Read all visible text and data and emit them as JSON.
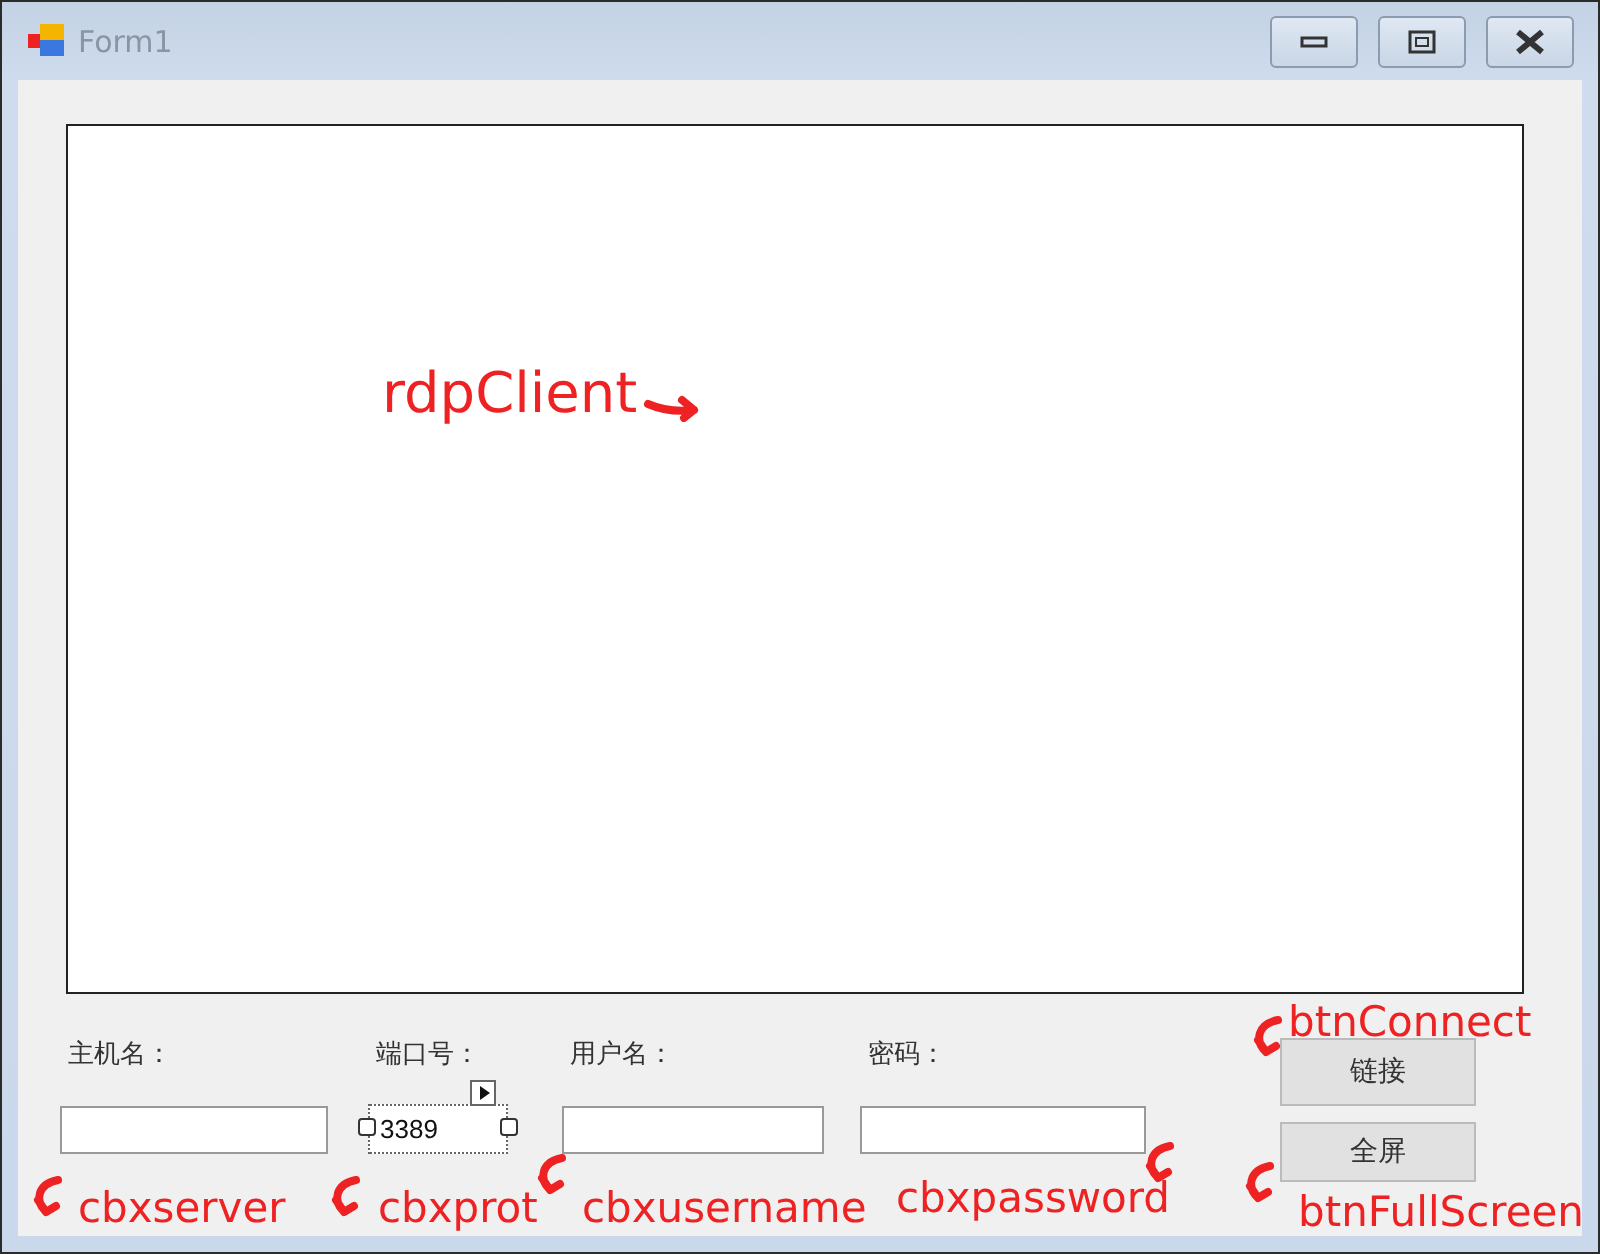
{
  "window": {
    "title": "Form1"
  },
  "rdp_panel": {
    "annotation": "rdpClient"
  },
  "fields": [
    {
      "label": "主机名：",
      "annotation": "cbxserver",
      "selected": false
    },
    {
      "label": "端口号：",
      "value": "3389",
      "annotation": "cbxprot",
      "selected": true
    },
    {
      "label": "用户名：",
      "annotation": "cbxusername",
      "selected": false
    },
    {
      "label": "密码：",
      "annotation": "cbxpassword",
      "selected": false
    }
  ],
  "buttons": [
    {
      "label": "链接",
      "annotation": "btnConnect"
    },
    {
      "label": "全屏",
      "annotation": "btnFullScreen"
    }
  ]
}
